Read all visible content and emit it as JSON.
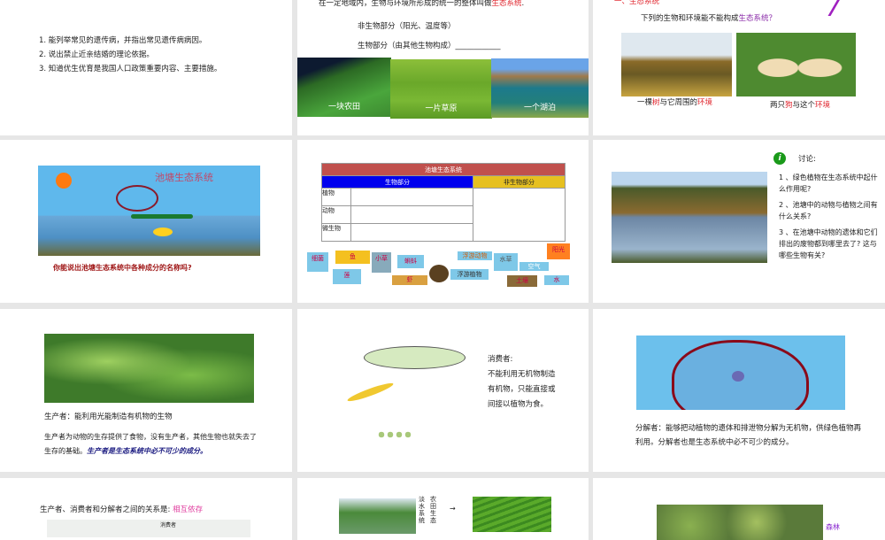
{
  "slides": [
    {
      "items": [
        "1. 能列举常见的遗传病，并指出常见遗传病病因。",
        "2. 说出禁止近亲结婚的理论依据。",
        "3. 知道优生优育是我国人口政策重要内容、主要措施。"
      ]
    },
    {
      "def_prefix": "在一定地域内，生物与环境所形成的统一的整体叫做",
      "def_term": "生态系统",
      "def_suffix": ".",
      "abiotic": "非生物部分（阳光、温度等）",
      "biotic": "生物部分（由其他生物构成）____________",
      "captions": [
        "一块农田",
        "一片草原",
        "一个湖泊"
      ]
    },
    {
      "heading": "一、生态系统",
      "question_prefix": "下列的生物和环境能不能构成",
      "question_term": "生态系统？",
      "cap1": [
        "一棵",
        "树",
        "与它周围的",
        "环境"
      ],
      "cap2": [
        "两只",
        "狗",
        "与这个",
        "环境"
      ]
    },
    {
      "image_title": "池塘生态系统",
      "question": "你能说出池塘生态系统中各种成分的名称吗?"
    },
    {
      "table_title": "池塘生态系统",
      "col_biotic": "生物部分",
      "col_abiotic": "非生物部分",
      "rows": [
        "植物",
        "动物",
        "微生物"
      ],
      "tags": [
        "细菌",
        "鱼",
        "小草",
        "蝌蚪",
        "莲",
        "虾",
        "浮游动物",
        "浮游植物",
        "水草",
        "空气",
        "阳光",
        "土壤",
        "水"
      ]
    },
    {
      "discuss_label": "讨论:",
      "questions": [
        "1 、绿色植物在生态系统中起什么作用呢?",
        "2 、池塘中的动物与植物之间有什么关系?",
        "3 、在池塘中动物的遗体和它们排出的废物都到哪里去了? 这与哪些生物有关?"
      ]
    },
    {
      "def": "生产者：能利用光能制造有机物的生物",
      "body": "生产者为动物的生存提供了食物，没有生产者，其他生物也就失去了生存的基础。",
      "emph": "生产者是生态系统中必不可少的成分。"
    },
    {
      "title": "消费者:",
      "body": "不能利用无机物制造有机物，只能直接或间接以植物为食。"
    },
    {
      "body": "分解者：能够把动植物的遗体和排泄物分解为无机物，供绿色植物再利用。分解者也是生态系统中必不可少的成分。"
    },
    {
      "relation_prefix": "生产者、消费者和分解者之间的关系是:",
      "relation_term": "相互依存",
      "diagram_label": "消费者"
    },
    {
      "label1": "淡水系统",
      "label2": "农田生态",
      "arrow": "→"
    },
    {
      "side_label": "森林"
    }
  ]
}
